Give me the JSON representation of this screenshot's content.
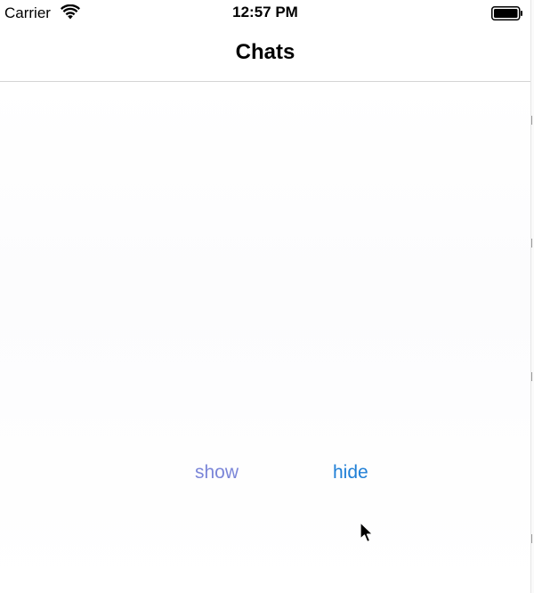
{
  "status_bar": {
    "carrier": "Carrier",
    "time": "12:57 PM",
    "wifi_icon": "wifi-icon",
    "battery_icon": "battery-icon"
  },
  "nav": {
    "title": "Chats"
  },
  "actions": {
    "show_label": "show",
    "hide_label": "hide"
  },
  "colors": {
    "show": "#7b86d8",
    "hide": "#1f7fd6",
    "divider": "#d4d4d4"
  }
}
